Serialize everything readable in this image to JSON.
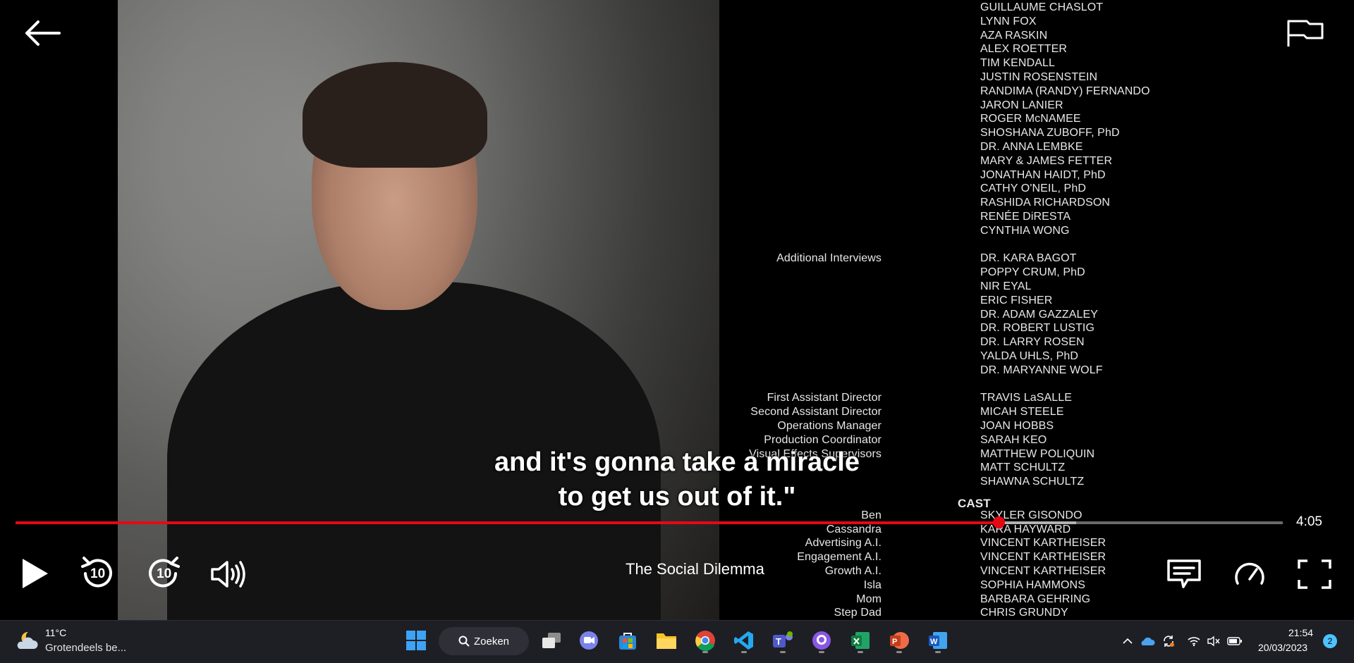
{
  "player": {
    "subtitle_line1": "and it's gonna take a miracle",
    "subtitle_line2": "to get us out of it.\"",
    "title": "The Social Dilemma",
    "time_remaining": "4:05",
    "progress": 0.776,
    "buffered": 0.837,
    "accent_color": "#e50914"
  },
  "credits": {
    "block1": [
      {
        "role": "",
        "name": "GUILLAUME CHASLOT"
      },
      {
        "role": "",
        "name": "LYNN FOX"
      },
      {
        "role": "",
        "name": "AZA RASKIN"
      },
      {
        "role": "",
        "name": "ALEX ROETTER"
      },
      {
        "role": "",
        "name": "TIM KENDALL"
      },
      {
        "role": "",
        "name": "JUSTIN ROSENSTEIN"
      },
      {
        "role": "",
        "name": "RANDIMA (RANDY) FERNANDO"
      },
      {
        "role": "",
        "name": "JARON LANIER"
      },
      {
        "role": "",
        "name": "ROGER McNAMEE"
      },
      {
        "role": "",
        "name": "SHOSHANA ZUBOFF, PhD"
      },
      {
        "role": "",
        "name": "DR. ANNA LEMBKE"
      },
      {
        "role": "",
        "name": "MARY & JAMES FETTER"
      },
      {
        "role": "",
        "name": "JONATHAN HAIDT, PhD"
      },
      {
        "role": "",
        "name": "CATHY O'NEIL, PhD"
      },
      {
        "role": "",
        "name": "RASHIDA RICHARDSON"
      },
      {
        "role": "",
        "name": "RENÉE DiRESTA"
      },
      {
        "role": "",
        "name": "CYNTHIA WONG"
      }
    ],
    "block2": [
      {
        "role": "Additional Interviews",
        "name": "DR. KARA BAGOT"
      },
      {
        "role": "",
        "name": "POPPY CRUM, PhD"
      },
      {
        "role": "",
        "name": "NIR EYAL"
      },
      {
        "role": "",
        "name": "ERIC FISHER"
      },
      {
        "role": "",
        "name": "DR. ADAM GAZZALEY"
      },
      {
        "role": "",
        "name": "DR. ROBERT LUSTIG"
      },
      {
        "role": "",
        "name": "DR. LARRY ROSEN"
      },
      {
        "role": "",
        "name": "YALDA UHLS, PhD"
      },
      {
        "role": "",
        "name": "DR. MARYANNE WOLF"
      }
    ],
    "block3": [
      {
        "role": "First Assistant Director",
        "name": "TRAVIS LaSALLE"
      },
      {
        "role": "Second Assistant Director",
        "name": "MICAH STEELE"
      },
      {
        "role": "Operations Manager",
        "name": "JOAN HOBBS"
      },
      {
        "role": "Production Coordinator",
        "name": "SARAH KEO"
      },
      {
        "role": "Visual Effects Supervisors",
        "name": "MATTHEW POLIQUIN"
      },
      {
        "role": "",
        "name": "MATT SCHULTZ"
      },
      {
        "role": "",
        "name": "SHAWNA SCHULTZ"
      }
    ],
    "cast_heading": "CAST",
    "cast": [
      {
        "role": "Ben",
        "name": "SKYLER GISONDO"
      },
      {
        "role": "Cassandra",
        "name": "KARA HAYWARD"
      },
      {
        "role": "Advertising A.I.",
        "name": "VINCENT KARTHEISER"
      },
      {
        "role": "Engagement A.I.",
        "name": "VINCENT KARTHEISER"
      },
      {
        "role": "Growth A.I.",
        "name": "VINCENT KARTHEISER"
      },
      {
        "role": "Isla",
        "name": "SOPHIA HAMMONS"
      },
      {
        "role": "Mom",
        "name": "BARBARA GEHRING"
      },
      {
        "role": "Step Dad",
        "name": "CHRIS GRUNDY"
      }
    ]
  },
  "controls": {
    "rewind_label": "10",
    "forward_label": "10"
  },
  "taskbar": {
    "weather_temp": "11°C",
    "weather_desc": "Grotendeels be...",
    "search_label": "Zoeken",
    "apps": [
      "windows-start",
      "task-view",
      "teams-chat",
      "microsoft-store",
      "file-explorer",
      "chrome",
      "vscode",
      "teams",
      "github-desktop",
      "excel",
      "powerpoint",
      "word"
    ],
    "clock_time": "21:54",
    "clock_date": "20/03/2023",
    "notification_count": "2"
  }
}
